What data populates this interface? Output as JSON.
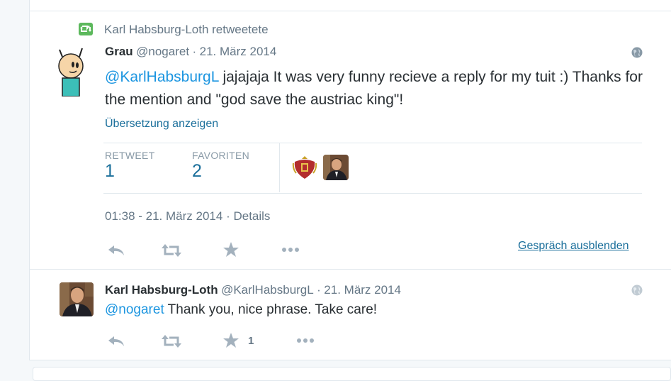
{
  "retweet_context": {
    "text": "Karl Habsburg-Loth retweetete"
  },
  "tweet1": {
    "name": "Grau",
    "handle": "@nogaret",
    "separator": "·",
    "date": "21. März 2014",
    "mention": "@KarlHabsburgL",
    "text": " jajajaja It was very funny recieve a reply for my tuit :) Thanks for the mention and \"god save the austriac king\"!",
    "translate_label": "Übersetzung anzeigen",
    "stats": {
      "retweet_label": "RETWEET",
      "retweet_count": "1",
      "favorites_label": "FAVORITEN",
      "favorites_count": "2"
    },
    "meta": {
      "time": "01:38 - 21. März 2014",
      "separator": "·",
      "details_label": "Details"
    },
    "hide_conversation_label": "Gespräch ausblenden"
  },
  "tweet2": {
    "name": "Karl Habsburg-Loth",
    "handle": "@KarlHabsburgL",
    "separator": "·",
    "date": "21. März 2014",
    "mention": "@nogaret",
    "text": " Thank you, nice phrase. Take care!",
    "favorite_count": "1"
  },
  "icons": {
    "retweet_context": "retweet-icon",
    "globe": "globe-icon",
    "reply": "reply-icon",
    "retweet": "retweet-icon",
    "favorite": "star-icon",
    "more": "more-dots-icon"
  },
  "colors": {
    "link": "#1b6f9b",
    "mention": "#1b95e0",
    "retweet_badge": "#5cb85c",
    "action_gray": "#8899a6"
  }
}
